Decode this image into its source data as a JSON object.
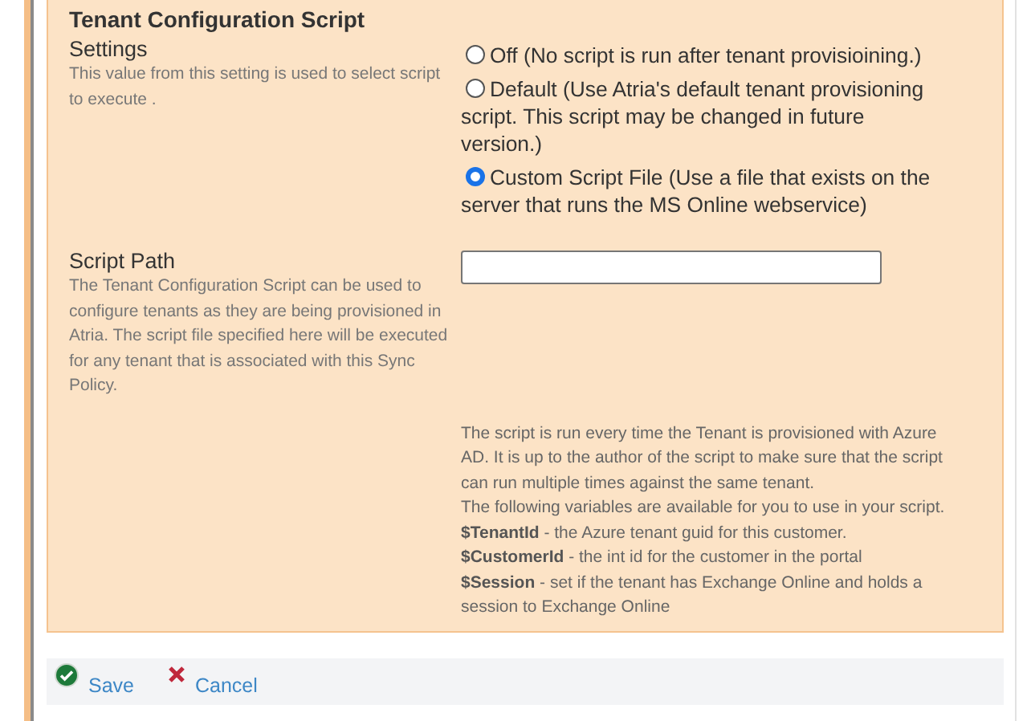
{
  "section": {
    "title": "Tenant Configuration Script",
    "settings": {
      "label": "Settings",
      "description": "This value from this setting is used to select script to execute .",
      "options": [
        {
          "label": "Off (No script is run after tenant provisioining.)",
          "selected": false
        },
        {
          "label": "Default (Use Atria's default tenant provisioning script. This script may be changed in future version.)",
          "selected": false
        },
        {
          "label": "Custom Script File (Use a file that exists on the server that runs the MS Online webservice)",
          "selected": true
        }
      ]
    },
    "script_path": {
      "label": "Script Path",
      "description": "The Tenant Configuration Script can be used to configure tenants as they are being provisioned in Atria. The script file specified here will be executed for any tenant that is associated with this Sync Policy."
    },
    "help": [
      "The script is run every time the Tenant is provisioned with Azure AD. It is up to the author of the script to make sure that the script can run multiple times against the same tenant.",
      "The following variables are available for you to use in your script.",
      "**$TenantId** - the Azure tenant guid for this customer.",
      "**$CustomerId** - the int id for the customer in the portal",
      "**$Session** - set if the tenant has Exchange Online and holds a session to Exchange Online"
    ]
  },
  "actions": [
    {
      "label": "Save",
      "kind": "save"
    },
    {
      "label": "Cancel",
      "kind": "cancel"
    }
  ]
}
